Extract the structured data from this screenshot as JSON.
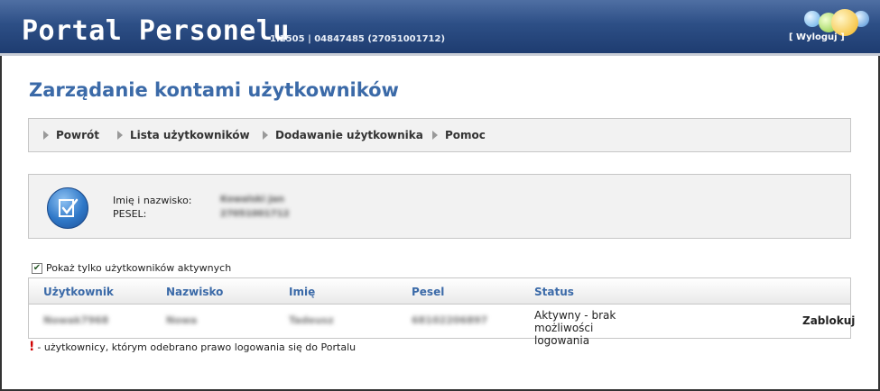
{
  "header": {
    "title": "Portal Personelu",
    "version": "1.2505 | 04847485 (27051001712)",
    "logout_label": "[ Wyloguj ]"
  },
  "page": {
    "title": "Zarządanie kontami użytkowników"
  },
  "nav": {
    "items": [
      {
        "label": "Powrót"
      },
      {
        "label": "Lista użytkowników"
      },
      {
        "label": "Dodawanie użytkownika"
      },
      {
        "label": "Pomoc"
      }
    ]
  },
  "user_info": {
    "name_label": "Imię i nazwisko:",
    "pesel_label": "PESEL:",
    "name_value": "Kowalski Jan",
    "pesel_value": "27051001712"
  },
  "filter": {
    "label": "Pokaż tylko użytkowników aktywnych",
    "checked": true
  },
  "table": {
    "columns": [
      "Użytkownik",
      "Nazwisko",
      "Imię",
      "Pesel",
      "Status"
    ],
    "rows": [
      {
        "user": "Nowak7968",
        "surname": "Nowa",
        "name": "Tadeusz",
        "pesel": "68102206897",
        "status": "Aktywny - brak możliwości logowania",
        "action": "Zablokuj"
      }
    ]
  },
  "footnote": {
    "marker": "!",
    "text": " - użytkownicy, którym odebrano prawo logowania się do Portalu"
  },
  "colors": {
    "header_blue": "#2d4f86",
    "title_blue": "#3b6aa8",
    "alert_red": "#d00000"
  }
}
